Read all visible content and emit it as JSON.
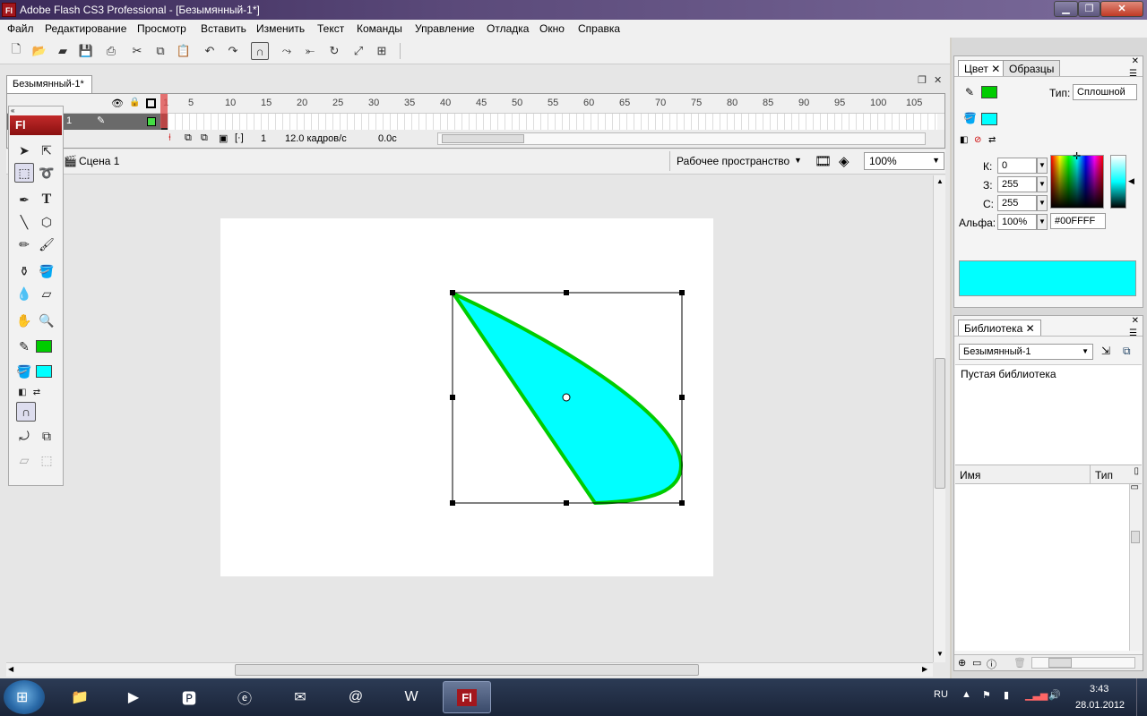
{
  "window": {
    "title": "Adobe Flash CS3 Professional - [Безымянный-1*]",
    "app_icon": "Fl"
  },
  "menu": [
    "Файл",
    "Редактирование",
    "Просмотр",
    "Вставить",
    "Изменить",
    "Текст",
    "Команды",
    "Управление",
    "Отладка",
    "Окно",
    "Справка"
  ],
  "document": {
    "tab": "Безымянный-1*"
  },
  "timeline": {
    "ruler": [
      "1",
      "5",
      "10",
      "15",
      "20",
      "25",
      "30",
      "35",
      "40",
      "45",
      "50",
      "55",
      "60",
      "65",
      "70",
      "75",
      "80",
      "85",
      "90",
      "95",
      "100",
      "105"
    ],
    "layer_name": "1",
    "current_frame": "1",
    "fps": "12.0 кадров/с",
    "time": "0.0с"
  },
  "editbar": {
    "scene": "Сцена 1",
    "workspace": "Рабочее пространство",
    "zoom": "100%"
  },
  "tools": {
    "logo": "Fl",
    "stroke_color": "#00CC00",
    "fill_color": "#00FFFF"
  },
  "color_panel": {
    "tab_color": "Цвет",
    "tab_swatches": "Образцы",
    "type_label": "Тип:",
    "type_value": "Сплошной",
    "r_label": "К:",
    "r_value": "0",
    "g_label": "З:",
    "g_value": "255",
    "b_label": "С:",
    "b_value": "255",
    "alpha_label": "Альфа:",
    "alpha_value": "100%",
    "hex": "#00FFFF",
    "preview_color": "#00FFFF"
  },
  "library_panel": {
    "tab": "Библиотека",
    "document": "Безымянный-1",
    "empty_text": "Пустая библиотека",
    "col_name": "Имя",
    "col_type": "Тип"
  },
  "shape": {
    "fill": "#00FFFF",
    "stroke": "#00CC00"
  },
  "taskbar": {
    "lang": "RU",
    "time": "3:43",
    "date": "28.01.2012"
  }
}
